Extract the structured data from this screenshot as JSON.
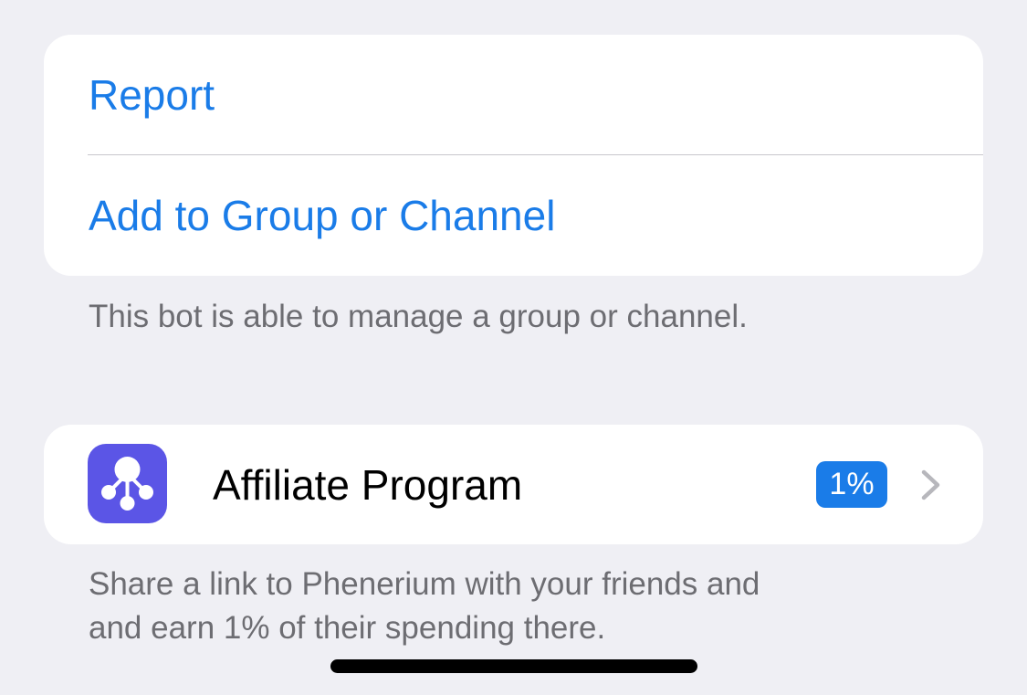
{
  "actions": {
    "report_label": "Report",
    "add_label": "Add to Group or Channel",
    "footnote": "This bot is able to manage a group or channel."
  },
  "affiliate": {
    "icon": "affiliate-network-icon",
    "label": "Affiliate Program",
    "badge": "1%",
    "chevron": "chevron-right-icon",
    "footnote_line1": "Share a link to Phenerium with your friends and",
    "footnote_line2": "and earn 1% of their spending there."
  },
  "colors": {
    "background": "#efeff4",
    "accent": "#1a7ce8",
    "icon_background": "#5b55e6",
    "footnote_text": "#6d6d72"
  }
}
